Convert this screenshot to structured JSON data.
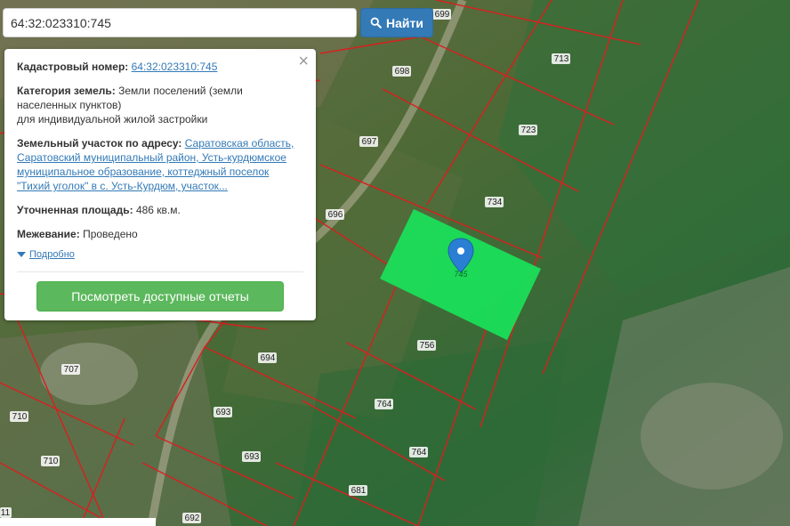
{
  "search": {
    "value": "64:32:023310:745",
    "button_label": "Найти"
  },
  "popup": {
    "close_label": "×",
    "cadastral": {
      "label": "Кадастровый номер:",
      "value": "64:32:023310:745"
    },
    "category": {
      "label": "Категория земель:",
      "line1": "Земли поселений (земли",
      "line2": "населенных пунктов)",
      "line3": "для индивидуальной жилой застройки"
    },
    "address": {
      "label": "Земельный участок по адресу:",
      "first": "Саратовская область,",
      "l2": "Саратовский муниципальный район, Усть-курдюмское",
      "l3": "муниципальное образование, коттеджный поселок",
      "l4": "\"Тихий уголок\" в с. Усть-Курдюм, участок..."
    },
    "area": {
      "label": "Уточненная площадь:",
      "value": "486 кв.м."
    },
    "survey": {
      "label": "Межевание:",
      "value": "Проведено"
    },
    "more_label": "Подробно",
    "report_button": "Посмотреть доступные отчеты"
  },
  "map": {
    "selected_parcel_color": "#19e35a",
    "marker_color": "#2a7fd4",
    "marker_label": "745",
    "parcel_labels": {
      "p699": "699",
      "p713": "713",
      "p698": "698",
      "p723": "723",
      "p697": "697",
      "p734": "734",
      "p696": "696",
      "p756": "756",
      "p707": "707",
      "p694": "694",
      "p764a": "764",
      "p710a": "710",
      "p693a": "693",
      "p693b": "693",
      "p764b": "764",
      "p710b": "710",
      "p681": "681",
      "p692": "692",
      "p711": "11"
    }
  }
}
